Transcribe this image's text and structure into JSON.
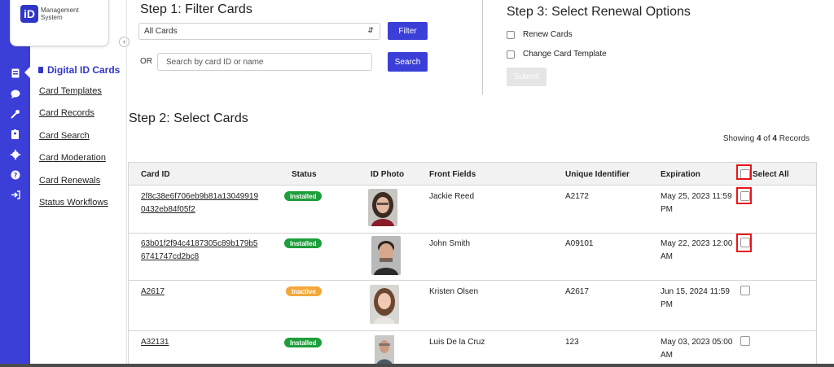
{
  "logo": {
    "mark": "iD",
    "line1": "Management",
    "line2": "System"
  },
  "rail": {
    "icons": [
      "card-icon",
      "chat-icon",
      "tools-icon",
      "id-badge-icon",
      "settings-icon",
      "help-icon",
      "logout-icon"
    ]
  },
  "subnav": {
    "title": "Digital ID Cards",
    "items": [
      {
        "label": "Card Templates"
      },
      {
        "label": "Card Records"
      },
      {
        "label": "Card Search"
      },
      {
        "label": "Card Moderation"
      },
      {
        "label": "Card Renewals"
      },
      {
        "label": "Status Workflows"
      }
    ]
  },
  "step1": {
    "heading": "Step 1: Filter Cards",
    "filter_value": "All Cards",
    "filter_button": "Filter",
    "or_label": "OR",
    "search_placeholder": "Search by card ID or name",
    "search_button": "Search"
  },
  "step2": {
    "heading": "Step 2: Select Cards"
  },
  "step3": {
    "heading": "Step 3: Select Renewal Options",
    "option1": "Renew Cards",
    "option2": "Change Card Template",
    "submit": "Submit"
  },
  "records": {
    "prefix": "Showing ",
    "shown": "4",
    "middle": " of ",
    "total": "4",
    "suffix": " Records"
  },
  "table": {
    "headers": {
      "card_id": "Card ID",
      "status": "Status",
      "photo": "ID Photo",
      "front": "Front Fields",
      "uid": "Unique Identifier",
      "expiration": "Expiration",
      "select_all": "Select All"
    },
    "rows": [
      {
        "card_id_1": "2f8c38e6f706eb9b81a13049919",
        "card_id_2": "0432eb84f05f2",
        "status": "Installed",
        "status_color": "#1e9e3a",
        "front": "Jackie Reed",
        "uid": "A2172",
        "exp_1": "May 25, 2023 11:59",
        "exp_2": "PM"
      },
      {
        "card_id_1": "63b01f2f94c4187305c89b179b5",
        "card_id_2": "6741747cd2bc8",
        "status": "Installed",
        "status_color": "#1e9e3a",
        "front": "John Smith",
        "uid": "A09101",
        "exp_1": "May 22, 2023 12:00",
        "exp_2": "AM"
      },
      {
        "card_id_1": "A2617",
        "card_id_2": "",
        "status": "Inactive",
        "status_color": "#f4a83a",
        "front": "Kristen Olsen",
        "uid": "A2617",
        "exp_1": "Jun 15, 2024 11:59",
        "exp_2": "PM"
      },
      {
        "card_id_1": "A32131",
        "card_id_2": "",
        "status": "Installed",
        "status_color": "#1e9e3a",
        "front": "Luis De la Cruz",
        "uid": "123",
        "exp_1": "May 03, 2023 05:00",
        "exp_2": "AM"
      }
    ]
  },
  "colors": {
    "accent": "#3b3fd8",
    "installed": "#1e9e3a",
    "inactive": "#f4a83a",
    "highlight": "#e8141b"
  }
}
